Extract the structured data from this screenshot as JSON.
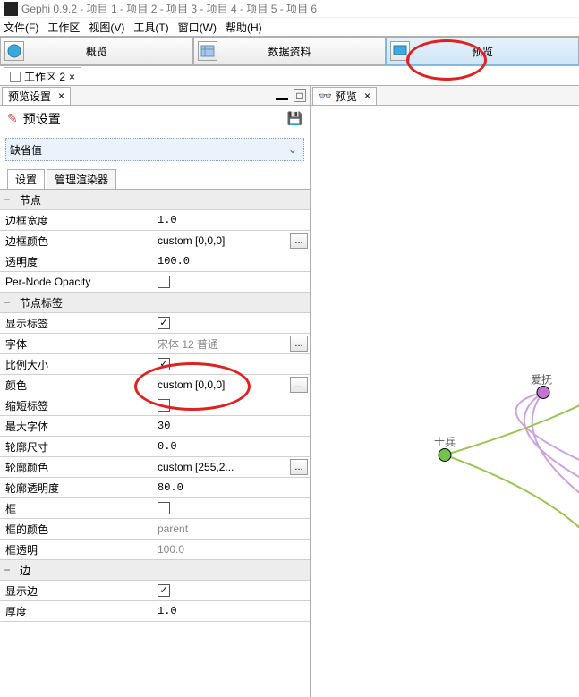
{
  "titlebar": {
    "text": "Gephi 0.9.2 - 项目 1 - 项目 2 - 项目 3 - 项目 4 - 项目 5 - 项目 6"
  },
  "menubar": {
    "file": "文件(F)",
    "work": "工作区",
    "view": "视图(V)",
    "tools": "工具(T)",
    "window": "窗口(W)",
    "help": "帮助(H)"
  },
  "maintabs": {
    "overview": "概览",
    "datalab": "数据资料",
    "preview": "预览"
  },
  "workspace_tab": {
    "label": "工作区 2",
    "close": "×"
  },
  "left": {
    "tab_label": "预览设置",
    "tab_close": "×",
    "preset_title": "预设置",
    "combo_value": "缺省值",
    "inner_tab_settings": "设置",
    "inner_tab_renderers": "管理渲染器",
    "groups": {
      "node": "节点",
      "nodelabel": "节点标签",
      "edge": "边"
    },
    "rows": {
      "border_width": {
        "k": "边框宽度",
        "v": "1.0"
      },
      "border_color": {
        "k": "边框颜色",
        "v": "custom [0,0,0]"
      },
      "opacity": {
        "k": "透明度",
        "v": "100.0"
      },
      "per_node_opac": {
        "k": "Per-Node Opacity"
      },
      "show_label": {
        "k": "显示标签"
      },
      "font": {
        "k": "字体",
        "v": "宋体 12 普通"
      },
      "prop_size": {
        "k": "比例大小"
      },
      "color": {
        "k": "颜色",
        "v": "custom [0,0,0]"
      },
      "shorten_label": {
        "k": "缩短标签"
      },
      "max_font": {
        "k": "最大字体",
        "v": "30"
      },
      "outline_size": {
        "k": "轮廓尺寸",
        "v": "0.0"
      },
      "outline_color": {
        "k": "轮廓颜色",
        "v": "custom [255,2..."
      },
      "outline_opac": {
        "k": "轮廓透明度",
        "v": "80.0"
      },
      "box": {
        "k": "框"
      },
      "box_color": {
        "k": "框的颜色",
        "v": "parent"
      },
      "box_opac": {
        "k": "框透明",
        "v": "100.0"
      },
      "show_edge": {
        "k": "显示边"
      },
      "thickness": {
        "k": "厚度",
        "v": "1.0"
      }
    }
  },
  "right": {
    "tab_label": "预览",
    "tab_close": "×",
    "node_label_1": "爱抚",
    "node_label_2": "士兵"
  },
  "icons": {
    "dots": "...",
    "check": "✓",
    "chev": "⌄",
    "minus": "−",
    "sq": "□"
  }
}
